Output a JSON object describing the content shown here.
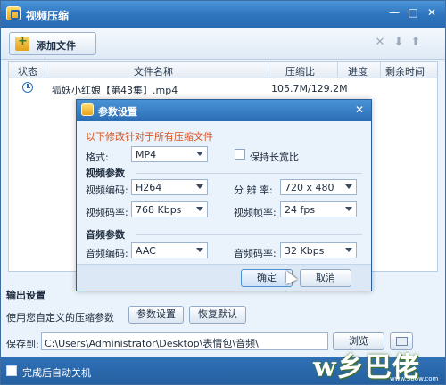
{
  "window": {
    "title": "视频压缩",
    "controls": {
      "minimize": "—",
      "maximize": "□",
      "close": "✕"
    }
  },
  "toolbar": {
    "add_file": "添加文件",
    "icons": [
      "close-icon",
      "arrow-down-icon",
      "arrow-up-icon"
    ]
  },
  "file_list": {
    "columns": [
      "状态",
      "文件名称",
      "压缩比",
      "进度",
      "剩余时间"
    ],
    "rows": [
      {
        "status_icon": "clock-icon",
        "name": "狐妖小红娘【第43集】.mp4",
        "ratio": "105.7M/129.2M",
        "progress": "",
        "remaining": ""
      }
    ]
  },
  "output": {
    "section_title": "输出设置",
    "params_label": "使用您自定义的压缩参数",
    "params_button": "参数设置",
    "reset_button": "恢复默认",
    "save_label": "保存到:",
    "save_path": "C:\\Users\\Administrator\\Desktop\\表情包\\音频\\",
    "browse_button": "浏览"
  },
  "footer": {
    "shutdown_label": "完成后自动关机",
    "shutdown_checked": false
  },
  "dialog": {
    "title": "参数设置",
    "notice": "以下修改针对于所有压缩文件",
    "format_label": "格式:",
    "format_value": "MP4",
    "keep_ratio_label": "保持长宽比",
    "keep_ratio_checked": false,
    "video_group": "视频参数",
    "video_codec_label": "视频编码:",
    "video_codec_value": "H264",
    "resolution_label": "分 辨 率:",
    "resolution_value": "720 x 480",
    "video_bitrate_label": "视频码率:",
    "video_bitrate_value": "768 Kbps",
    "frame_rate_label": "视频帧率:",
    "frame_rate_value": "24 fps",
    "audio_group": "音频参数",
    "audio_codec_label": "音频编码:",
    "audio_codec_value": "AAC",
    "audio_bitrate_label": "音频码率:",
    "audio_bitrate_value": "32 Kbps",
    "ok_button": "确定",
    "cancel_button": "取消",
    "close": "✕"
  },
  "watermark": {
    "text": "w乡巴佬",
    "url": "www.386w.com"
  },
  "colors": {
    "title_bar": "#2d73bd",
    "notice": "#d9531e",
    "window_bg": "#eaf2fb"
  }
}
